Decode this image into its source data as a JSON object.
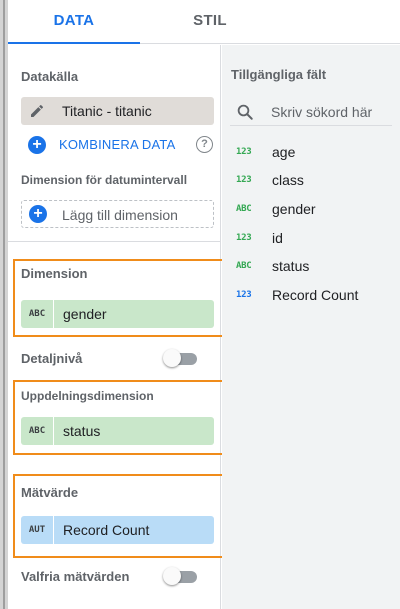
{
  "tabs": [
    {
      "label": "DATA"
    },
    {
      "label": "STIL"
    }
  ],
  "data_panel": {
    "source_label": "Datakälla",
    "source_name": "Titanic - titanic",
    "blend_label": "KOMBINERA DATA",
    "date_range_label": "Dimension för datumintervall",
    "add_dimension_label": "Lägg till dimension",
    "dimension_label": "Dimension",
    "dimension_field": {
      "type": "ABC",
      "name": "gender"
    },
    "drilldown_label": "Detaljnivå",
    "breakdown_label": "Uppdelningsdimension",
    "breakdown_field": {
      "type": "ABC",
      "name": "status"
    },
    "metric_label": "Mätvärde",
    "metric_field": {
      "type": "AUT",
      "name": "Record Count"
    },
    "optional_metrics_label": "Valfria mätvärden"
  },
  "available_fields": {
    "title": "Tillgängliga fält",
    "search_placeholder": "Skriv sökord här",
    "items": [
      {
        "type": "123",
        "name": "age"
      },
      {
        "type": "123",
        "name": "class"
      },
      {
        "type": "ABC",
        "name": "gender"
      },
      {
        "type": "123",
        "name": "id"
      },
      {
        "type": "ABC",
        "name": "status"
      },
      {
        "type": "123",
        "name": "Record Count"
      }
    ]
  },
  "colors": {
    "accent": "#1a73e8",
    "dimension_chip": "#c9e7ca",
    "metric_chip": "#b9dcf7",
    "highlight": "#f08c1a"
  }
}
